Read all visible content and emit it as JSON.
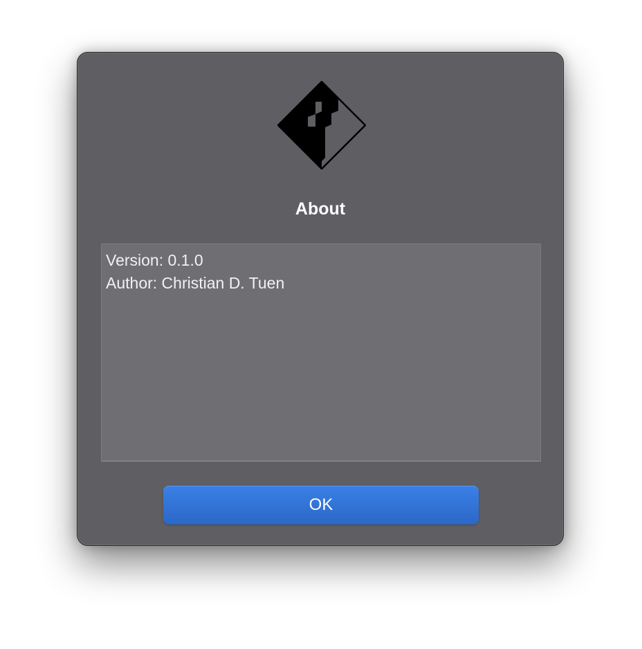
{
  "dialog": {
    "logo_icon": "diamond-f-logo-icon",
    "title": "About",
    "info_lines": [
      "Version: 0.1.0",
      "Author: Christian D. Tuen"
    ],
    "ok_label": "OK"
  },
  "colors": {
    "dialog_background": "#5f5e63",
    "info_box_background": "#6f6e73",
    "button_accent": "#2f74da",
    "text": "#ffffff"
  }
}
